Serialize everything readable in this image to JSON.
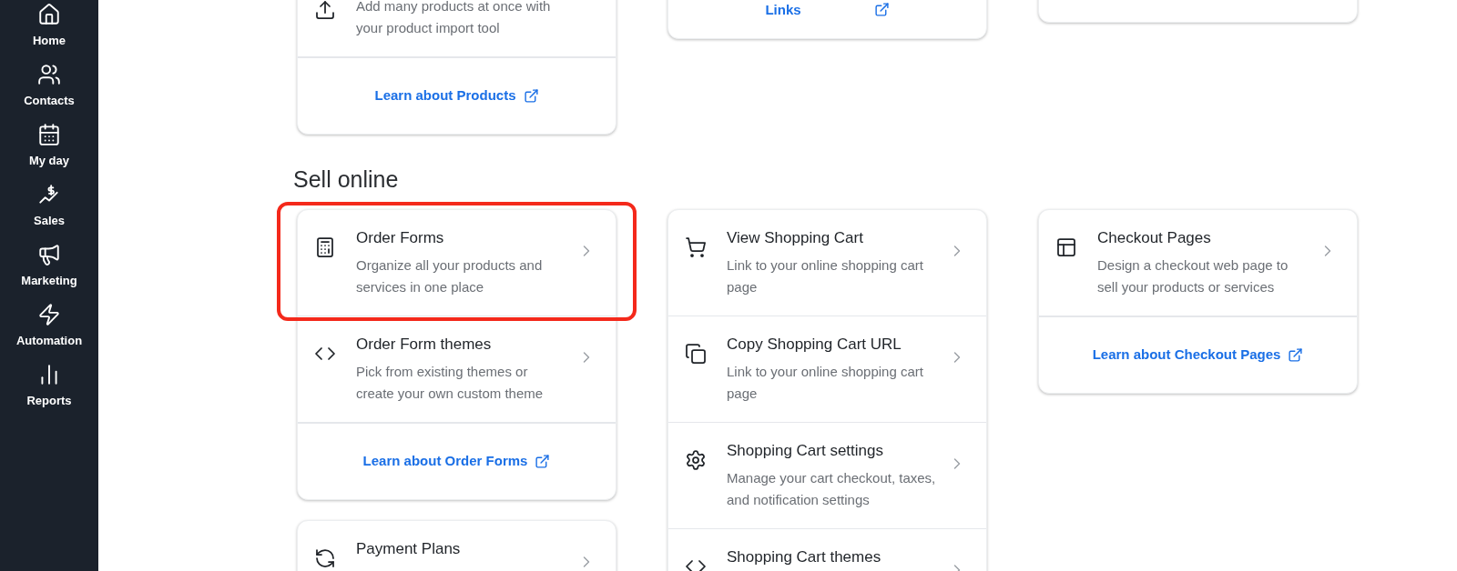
{
  "sidebar": {
    "items": [
      {
        "label": "Home",
        "kind": "home"
      },
      {
        "label": "Contacts",
        "kind": "contacts"
      },
      {
        "label": "My day",
        "kind": "calendar"
      },
      {
        "label": "Sales",
        "kind": "sales"
      },
      {
        "label": "Marketing",
        "kind": "megaphone"
      },
      {
        "label": "Automation",
        "kind": "bolt"
      },
      {
        "label": "Reports",
        "kind": "chart"
      }
    ]
  },
  "top_cards": [
    {
      "items": [
        {
          "kind": "upload",
          "description": "Add many products at once with your product import tool"
        }
      ],
      "link": "Learn about Products"
    },
    {
      "link": "Links"
    },
    {
      "kind": "empty"
    }
  ],
  "section": {
    "heading": "Sell online",
    "columns": [
      [
        {
          "items": [
            {
              "kind": "receipt",
              "title": "Order Forms",
              "description": "Organize all your products and services in one place",
              "highlighted": true
            },
            {
              "kind": "code",
              "title": "Order Form themes",
              "description": "Pick from existing themes or create your own custom theme",
              "highlighted": false
            }
          ],
          "link": "Learn about Order Forms"
        },
        {
          "items": [
            {
              "kind": "payment",
              "title": "Payment Plans",
              "highlighted": false
            }
          ]
        }
      ],
      [
        {
          "items": [
            {
              "kind": "cart",
              "title": "View Shopping Cart",
              "description": "Link to your online shopping cart page",
              "highlighted": false
            },
            {
              "kind": "copy",
              "title": "Copy Shopping Cart URL",
              "description": "Link to your online shopping cart page",
              "highlighted": false
            },
            {
              "kind": "gear",
              "title": "Shopping Cart settings",
              "description": "Manage your cart checkout, taxes, and notification settings",
              "highlighted": false
            },
            {
              "kind": "code",
              "title": "Shopping Cart themes",
              "highlighted": false
            }
          ]
        }
      ],
      [
        {
          "items": [
            {
              "kind": "layout",
              "title": "Checkout Pages",
              "description": "Design a checkout web page to sell your products or services",
              "highlighted": false
            }
          ],
          "link": "Learn about Checkout Pages"
        }
      ]
    ]
  }
}
